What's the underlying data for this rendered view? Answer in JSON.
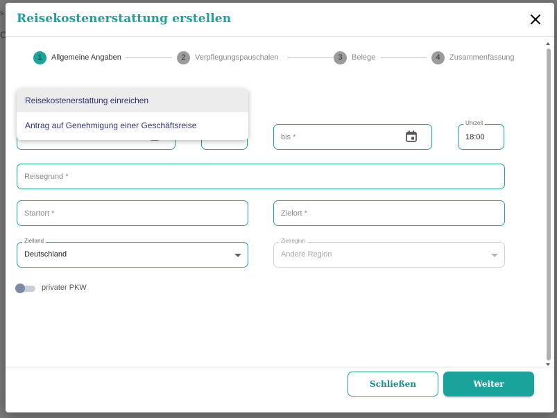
{
  "dialog": {
    "title": "Reisekostenerstattung erstellen",
    "close_icon": "close-icon"
  },
  "stepper": {
    "steps": [
      {
        "num": "1",
        "label": "Allgemeine Angaben",
        "active": true
      },
      {
        "num": "2",
        "label": "Verpflegungspauschalen",
        "active": false
      },
      {
        "num": "3",
        "label": "Belege",
        "active": false
      },
      {
        "num": "4",
        "label": "Zusammenfassung",
        "active": false
      }
    ]
  },
  "dropdown_menu": {
    "items": [
      "Reisekostenerstattung einreichen",
      "Antrag auf Genehmigung einer Geschäftsreise"
    ]
  },
  "form": {
    "bis_placeholder": "bis *",
    "uhrzeit_label": "Uhrzeit",
    "uhrzeit_value": "18:00",
    "reisegrund_placeholder": "Reisegrund *",
    "startort_placeholder": "Startort *",
    "zielort_placeholder": "Zielort *",
    "zielland_label": "Zielland",
    "zielland_value": "Deutschland",
    "zielregion_label": "Zielregion",
    "zielregion_value": "Andere Region",
    "private_car_label": "privater PKW"
  },
  "footer": {
    "close_label": "Schließen",
    "next_label": "Weiter"
  },
  "colors": {
    "accent": "#1aa39a",
    "menu_text": "#2d2f7a"
  }
}
